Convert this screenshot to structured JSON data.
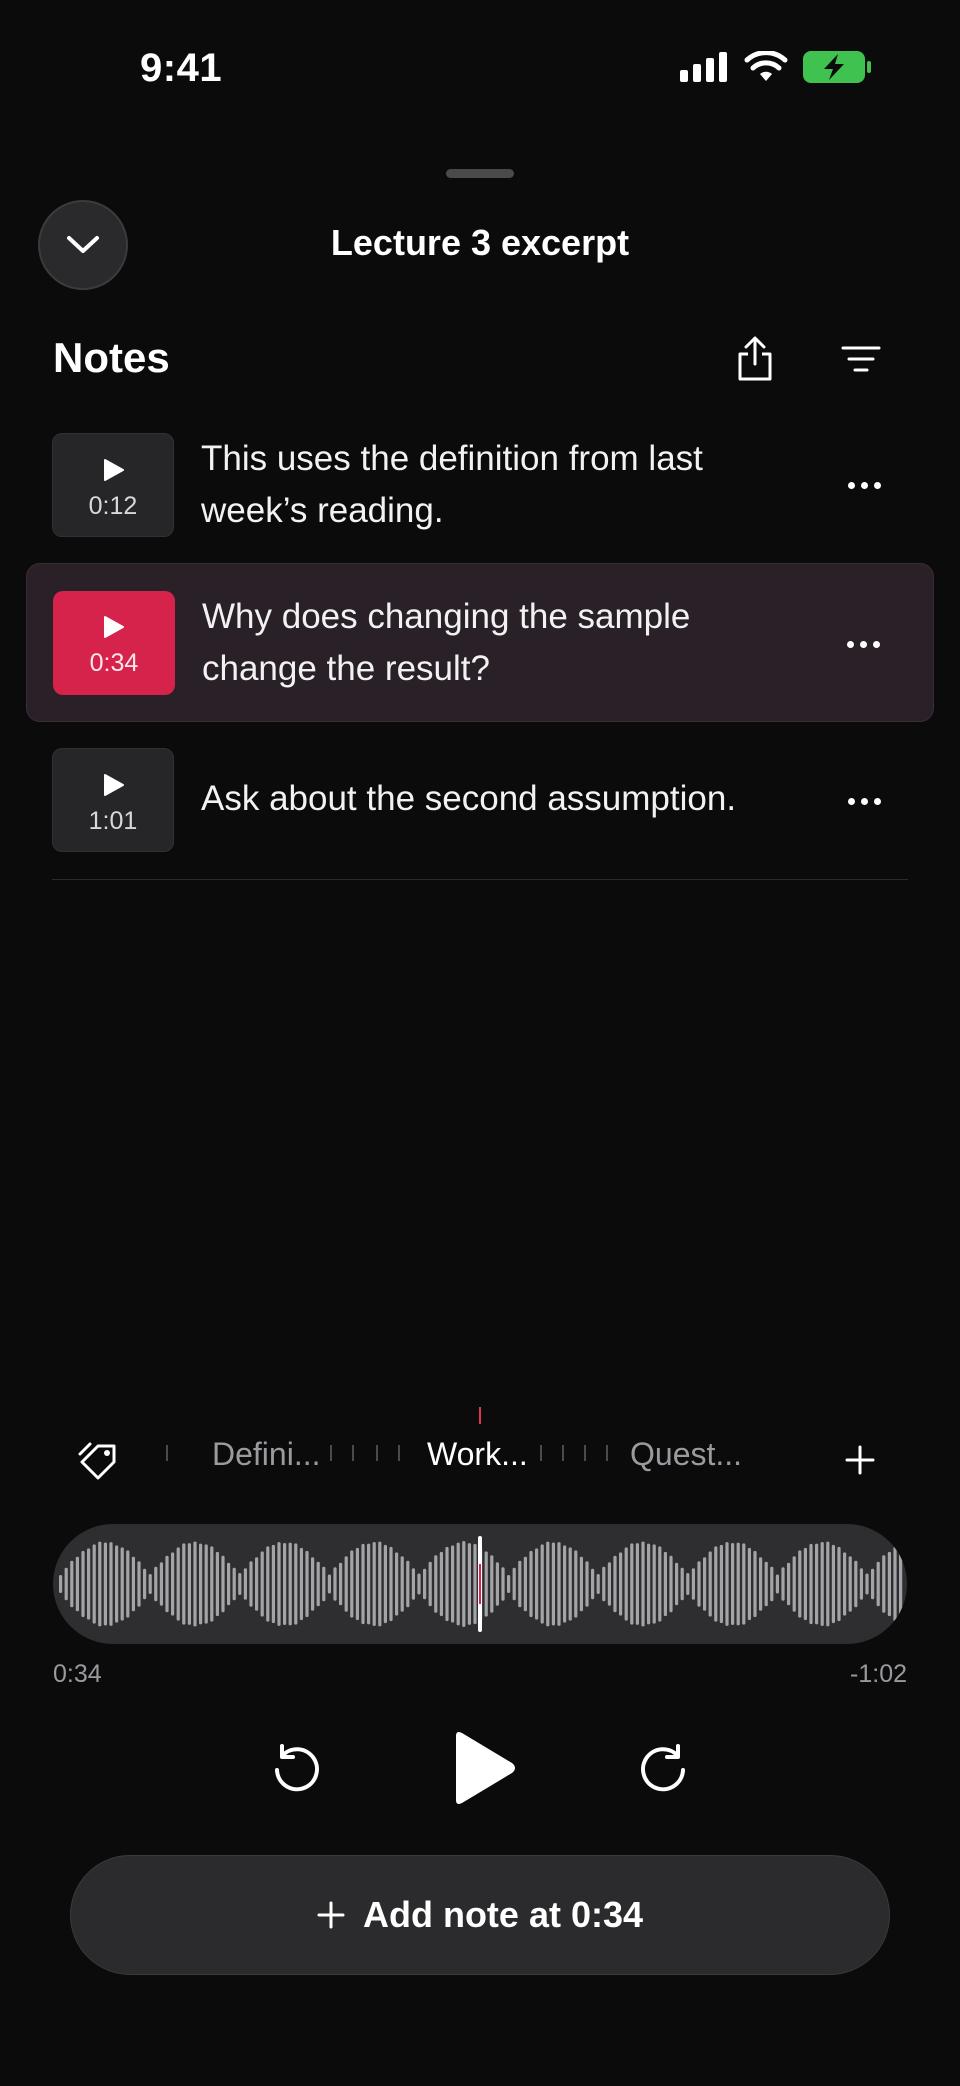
{
  "status_bar": {
    "time": "9:41"
  },
  "sheet": {
    "title": "Lecture 3 excerpt"
  },
  "notes": {
    "heading": "Notes",
    "items": [
      {
        "timestamp": "0:12",
        "text": "This uses the definition from last week’s reading.",
        "active": false
      },
      {
        "timestamp": "0:34",
        "text": "Why does changing the sample change the result?",
        "active": true
      },
      {
        "timestamp": "1:01",
        "text": "Ask about the second assumption.",
        "active": false
      }
    ]
  },
  "tags": {
    "items": [
      "Defini...",
      "Work...",
      "Quest..."
    ],
    "selected": "Work..."
  },
  "player": {
    "elapsed": "0:34",
    "remaining": "-1:02",
    "add_note_label": "Add note at 0:34"
  },
  "colors": {
    "accent": "#d6234c",
    "background": "#0b0b0c",
    "surface": "#2b2b2d"
  },
  "icons": {
    "collapse": "chevron-down-icon",
    "share": "share-icon",
    "sort": "sort-lines-icon",
    "tag": "tag-icon",
    "add": "plus-icon",
    "rewind": "rewind-icon",
    "play": "play-icon",
    "forward": "forward-icon",
    "more": "more-icon"
  }
}
